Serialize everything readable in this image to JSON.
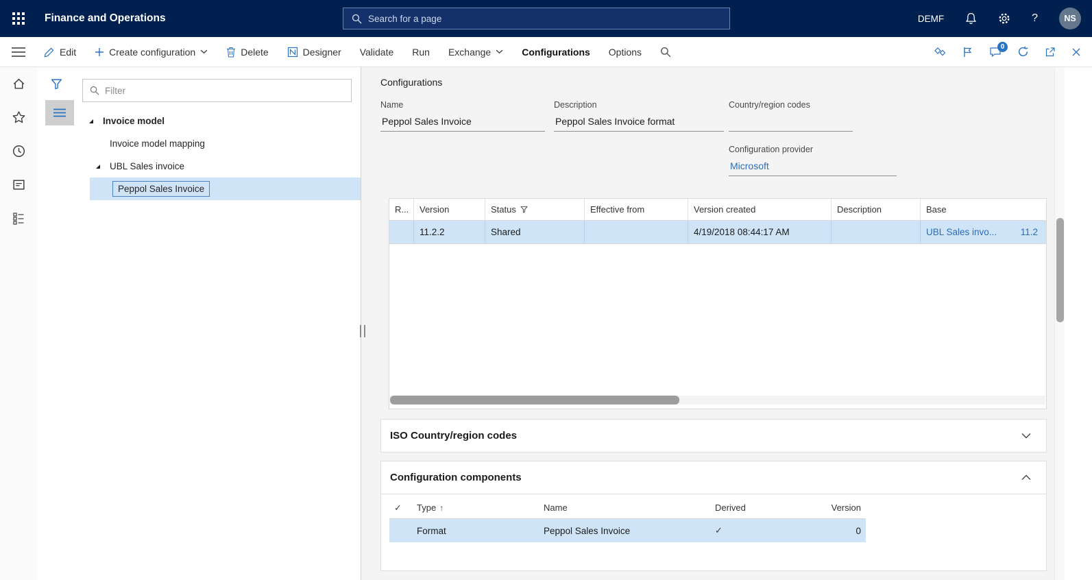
{
  "colors": {
    "topbar_bg": "#002050",
    "accent_blue": "#2a72c3",
    "link_blue": "#2b6cb5",
    "selection_bg": "#cfe4f7"
  },
  "topbar": {
    "app_title": "Finance and Operations",
    "search_placeholder": "Search for a page",
    "company": "DEMF",
    "avatar_initials": "NS"
  },
  "actionbar": {
    "edit": "Edit",
    "create_configuration": "Create configuration",
    "delete_label": "Delete",
    "designer": "Designer",
    "validate": "Validate",
    "run": "Run",
    "exchange": "Exchange",
    "configurations": "Configurations",
    "options": "Options",
    "message_badge_count": "0"
  },
  "tree_panel": {
    "filter_placeholder": "Filter",
    "items": [
      {
        "label": "Invoice model"
      },
      {
        "label": "Invoice model mapping"
      },
      {
        "label": "UBL Sales invoice"
      },
      {
        "label": "Peppol Sales Invoice"
      }
    ]
  },
  "main": {
    "page_caption": "Configurations",
    "fields": {
      "name_label": "Name",
      "name_value": "Peppol Sales Invoice",
      "description_label": "Description",
      "description_value": "Peppol Sales Invoice format",
      "country_label": "Country/region codes",
      "country_value": "",
      "provider_label": "Configuration provider",
      "provider_value": "Microsoft"
    },
    "versions_grid": {
      "columns": [
        "R...",
        "Version",
        "Status",
        "Effective from",
        "Version created",
        "Description",
        "Base"
      ],
      "rows": [
        {
          "version": "11.2.2",
          "status": "Shared",
          "effective_from": "",
          "version_created": "4/19/2018 08:44:17 AM",
          "description": "",
          "base_link": "UBL Sales invo...",
          "base_version": "11.2"
        }
      ]
    },
    "sections": {
      "iso_title": "ISO Country/region codes",
      "components_title": "Configuration components"
    },
    "components_grid": {
      "columns": [
        "Type",
        "Name",
        "Derived",
        "Version"
      ],
      "rows": [
        {
          "type": "Format",
          "name": "Peppol Sales Invoice",
          "derived": true,
          "version": "0"
        }
      ]
    }
  }
}
